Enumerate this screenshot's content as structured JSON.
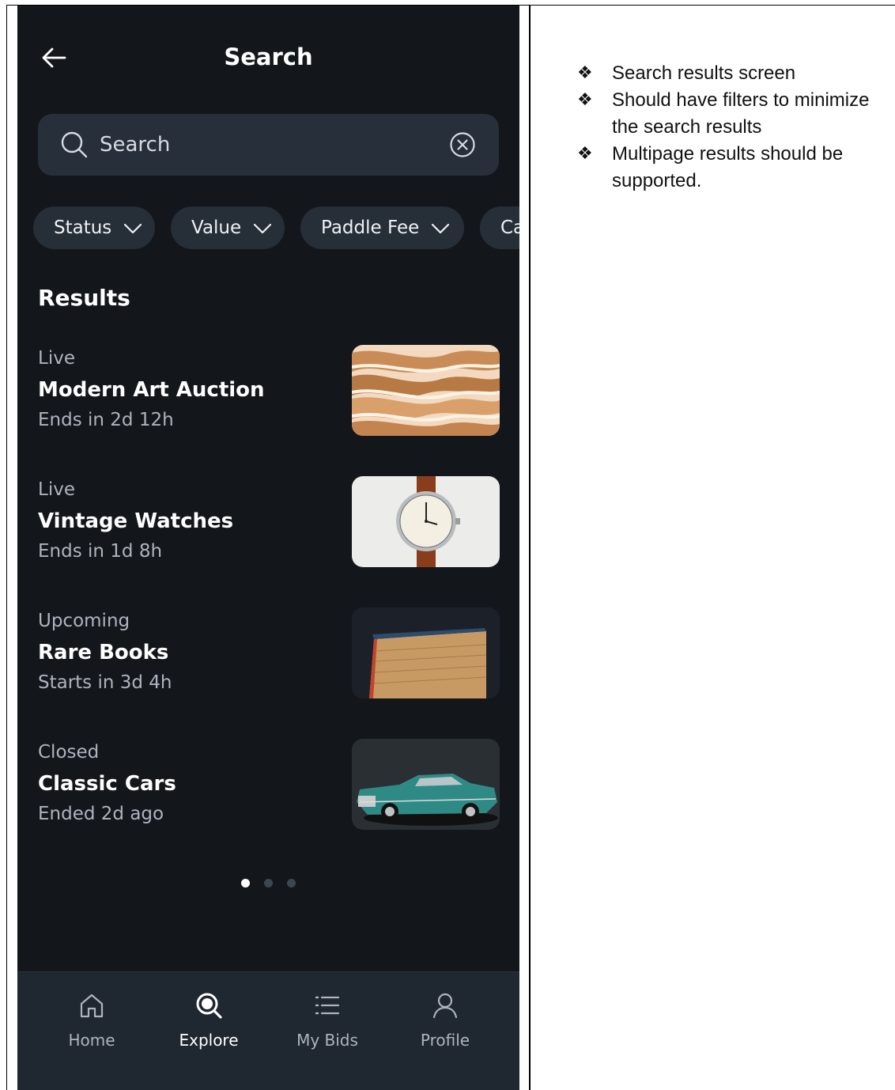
{
  "app": {
    "title": "Search",
    "search": {
      "placeholder": "Search",
      "value": ""
    },
    "filters": [
      {
        "label": "Status"
      },
      {
        "label": "Value"
      },
      {
        "label": "Paddle Fee"
      },
      {
        "label": "Ca"
      }
    ],
    "results_heading": "Results",
    "results": [
      {
        "status": "Live",
        "title": "Modern Art Auction",
        "time": "Ends in 2d 12h",
        "image": "abstract-art-thumbnail"
      },
      {
        "status": "Live",
        "title": "Vintage Watches",
        "time": "Ends in 1d 8h",
        "image": "watch-thumbnail"
      },
      {
        "status": "Upcoming",
        "title": "Rare Books",
        "time": "Starts in 3d 4h",
        "image": "book-thumbnail"
      },
      {
        "status": "Closed",
        "title": "Classic Cars",
        "time": "Ended 2d ago",
        "image": "car-thumbnail"
      }
    ],
    "pagination": {
      "pages": 3,
      "current": 1
    },
    "nav": [
      {
        "label": "Home",
        "icon": "home-icon",
        "active": false
      },
      {
        "label": "Explore",
        "icon": "search-icon",
        "active": true
      },
      {
        "label": "My Bids",
        "icon": "list-icon",
        "active": false
      },
      {
        "label": "Profile",
        "icon": "user-icon",
        "active": false
      }
    ],
    "colors": {
      "background": "#13171c",
      "surface": "#272f3a",
      "nav_bg": "#1f2731",
      "muted_text": "#aeb4bd"
    }
  },
  "notes": [
    "Search results screen",
    "Should have filters to minimize the search results",
    "Multipage results should be supported."
  ],
  "note_bullet": "❖"
}
